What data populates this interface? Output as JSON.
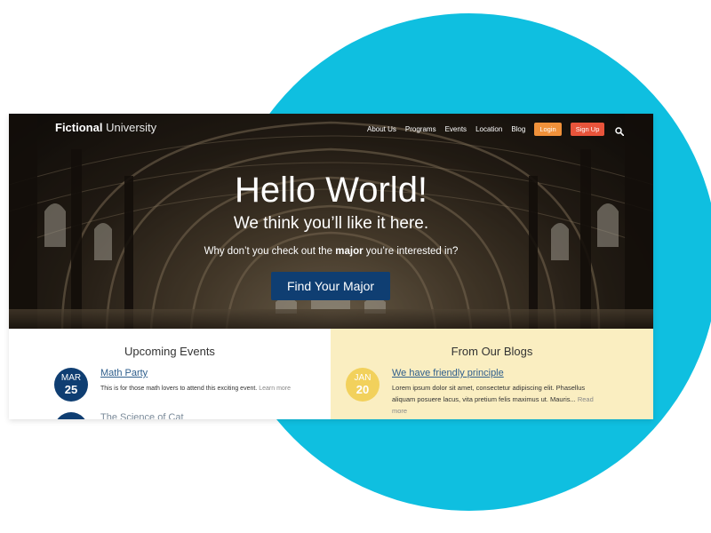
{
  "site": {
    "logo_bold": "Fictional",
    "logo_light": "University",
    "nav": {
      "about": "About Us",
      "programs": "Programs",
      "events": "Events",
      "location": "Location",
      "blog": "Blog",
      "login": "Login",
      "signup": "Sign Up",
      "search_icon": "search-icon"
    }
  },
  "hero": {
    "title": "Hello World!",
    "subtitle": "We think you’ll like it here.",
    "line_before": "Why don’t you check out the ",
    "line_bold": "major",
    "line_after": " you’re interested in?",
    "cta": "Find Your Major"
  },
  "events": {
    "heading": "Upcoming Events",
    "items": [
      {
        "month": "MAR",
        "day": "25",
        "title": "Math Party",
        "desc": "This is for those math lovers to attend this exciting event.",
        "read": "Learn more"
      },
      {
        "month": "",
        "day": "",
        "title": "The Science of Cat",
        "desc": "",
        "read": ""
      }
    ]
  },
  "blogs": {
    "heading": "From Our Blogs",
    "items": [
      {
        "month": "JAN",
        "day": "20",
        "title": "We have friendly principle",
        "desc": "Lorem ipsum dolor sit amet, consectetur adipiscing elit. Phasellus aliquam posuere lacus, vita pretium felis maximus ut. Mauris...",
        "read": "Read more"
      }
    ]
  },
  "colors": {
    "circle": "#0fbfe0",
    "navy": "#0f3e72",
    "login": "#f0913a",
    "signup": "#e8543b",
    "blog_bg": "#faeec1",
    "blog_date": "#f2d15c"
  }
}
